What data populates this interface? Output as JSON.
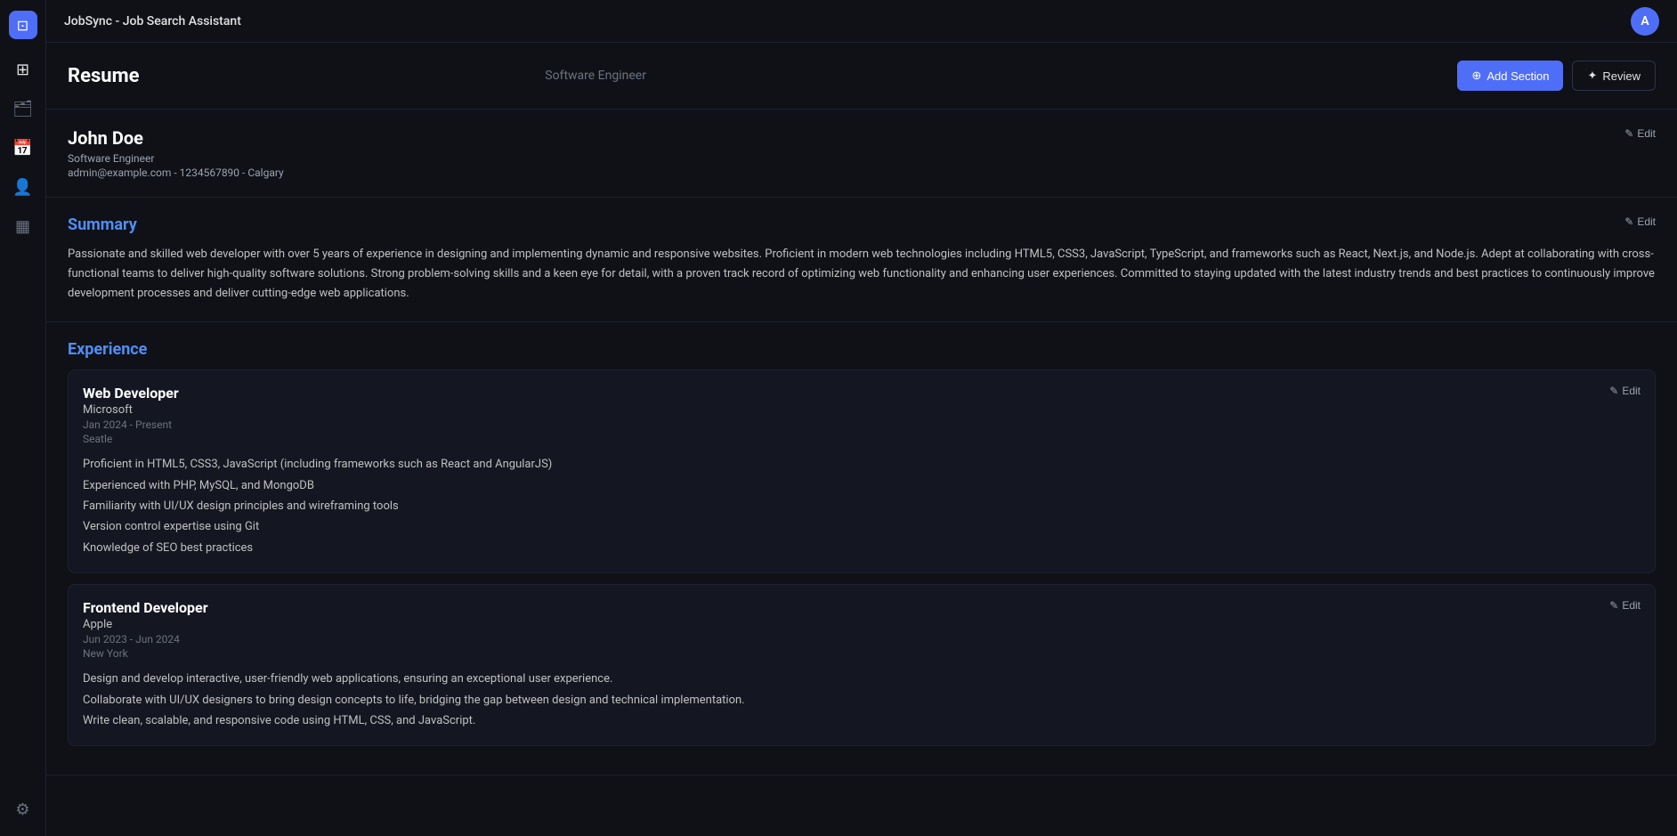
{
  "app": {
    "title": "JobSync - Job Search Assistant"
  },
  "topbar": {
    "title": "JobSync - Job Search Assistant",
    "avatar_initials": "A"
  },
  "sidebar": {
    "icons": [
      {
        "name": "grid-icon",
        "symbol": "⊞",
        "active": true
      },
      {
        "name": "briefcase-icon",
        "symbol": "💼"
      },
      {
        "name": "calendar-icon",
        "symbol": "📅"
      },
      {
        "name": "user-icon",
        "symbol": "👤"
      },
      {
        "name": "table-icon",
        "symbol": "▦"
      },
      {
        "name": "settings-icon",
        "symbol": "⚙"
      }
    ]
  },
  "resume": {
    "header": {
      "title": "Resume",
      "subtitle": "Software Engineer",
      "add_section_label": "Add Section",
      "review_label": "Review"
    },
    "profile": {
      "name": "John Doe",
      "role": "Software Engineer",
      "contact": "admin@example.com - 1234567890 - Calgary",
      "edit_label": "Edit"
    },
    "summary": {
      "title": "Summary",
      "edit_label": "Edit",
      "text": "Passionate and skilled web developer with over 5 years of experience in designing and implementing dynamic and responsive websites. Proficient in modern web technologies including HTML5, CSS3, JavaScript, TypeScript, and frameworks such as React, Next.js, and Node.js. Adept at collaborating with cross-functional teams to deliver high-quality software solutions. Strong problem-solving skills and a keen eye for detail, with a proven track record of optimizing web functionality and enhancing user experiences. Committed to staying updated with the latest industry trends and best practices to continuously improve development processes and deliver cutting-edge web applications."
    },
    "experience": {
      "title": "Experience",
      "items": [
        {
          "title": "Web Developer",
          "company": "Microsoft",
          "date": "Jan 2024 - Present",
          "location": "Seatle",
          "bullets": [
            "Proficient in HTML5, CSS3, JavaScript (including frameworks such as React and AngularJS)",
            "Experienced with PHP, MySQL, and MongoDB",
            "Familiarity with UI/UX design principles and wireframing tools",
            "Version control expertise using Git",
            "Knowledge of SEO best practices"
          ],
          "edit_label": "Edit"
        },
        {
          "title": "Frontend Developer",
          "company": "Apple",
          "date": "Jun 2023 - Jun 2024",
          "location": "New York",
          "bullets": [
            "Design and develop interactive, user-friendly web applications, ensuring an exceptional user experience.",
            "Collaborate with UI/UX designers to bring design concepts to life, bridging the gap between design and technical implementation.",
            "Write clean, scalable, and responsive code using HTML, CSS, and JavaScript."
          ],
          "edit_label": "Edit"
        }
      ]
    }
  }
}
